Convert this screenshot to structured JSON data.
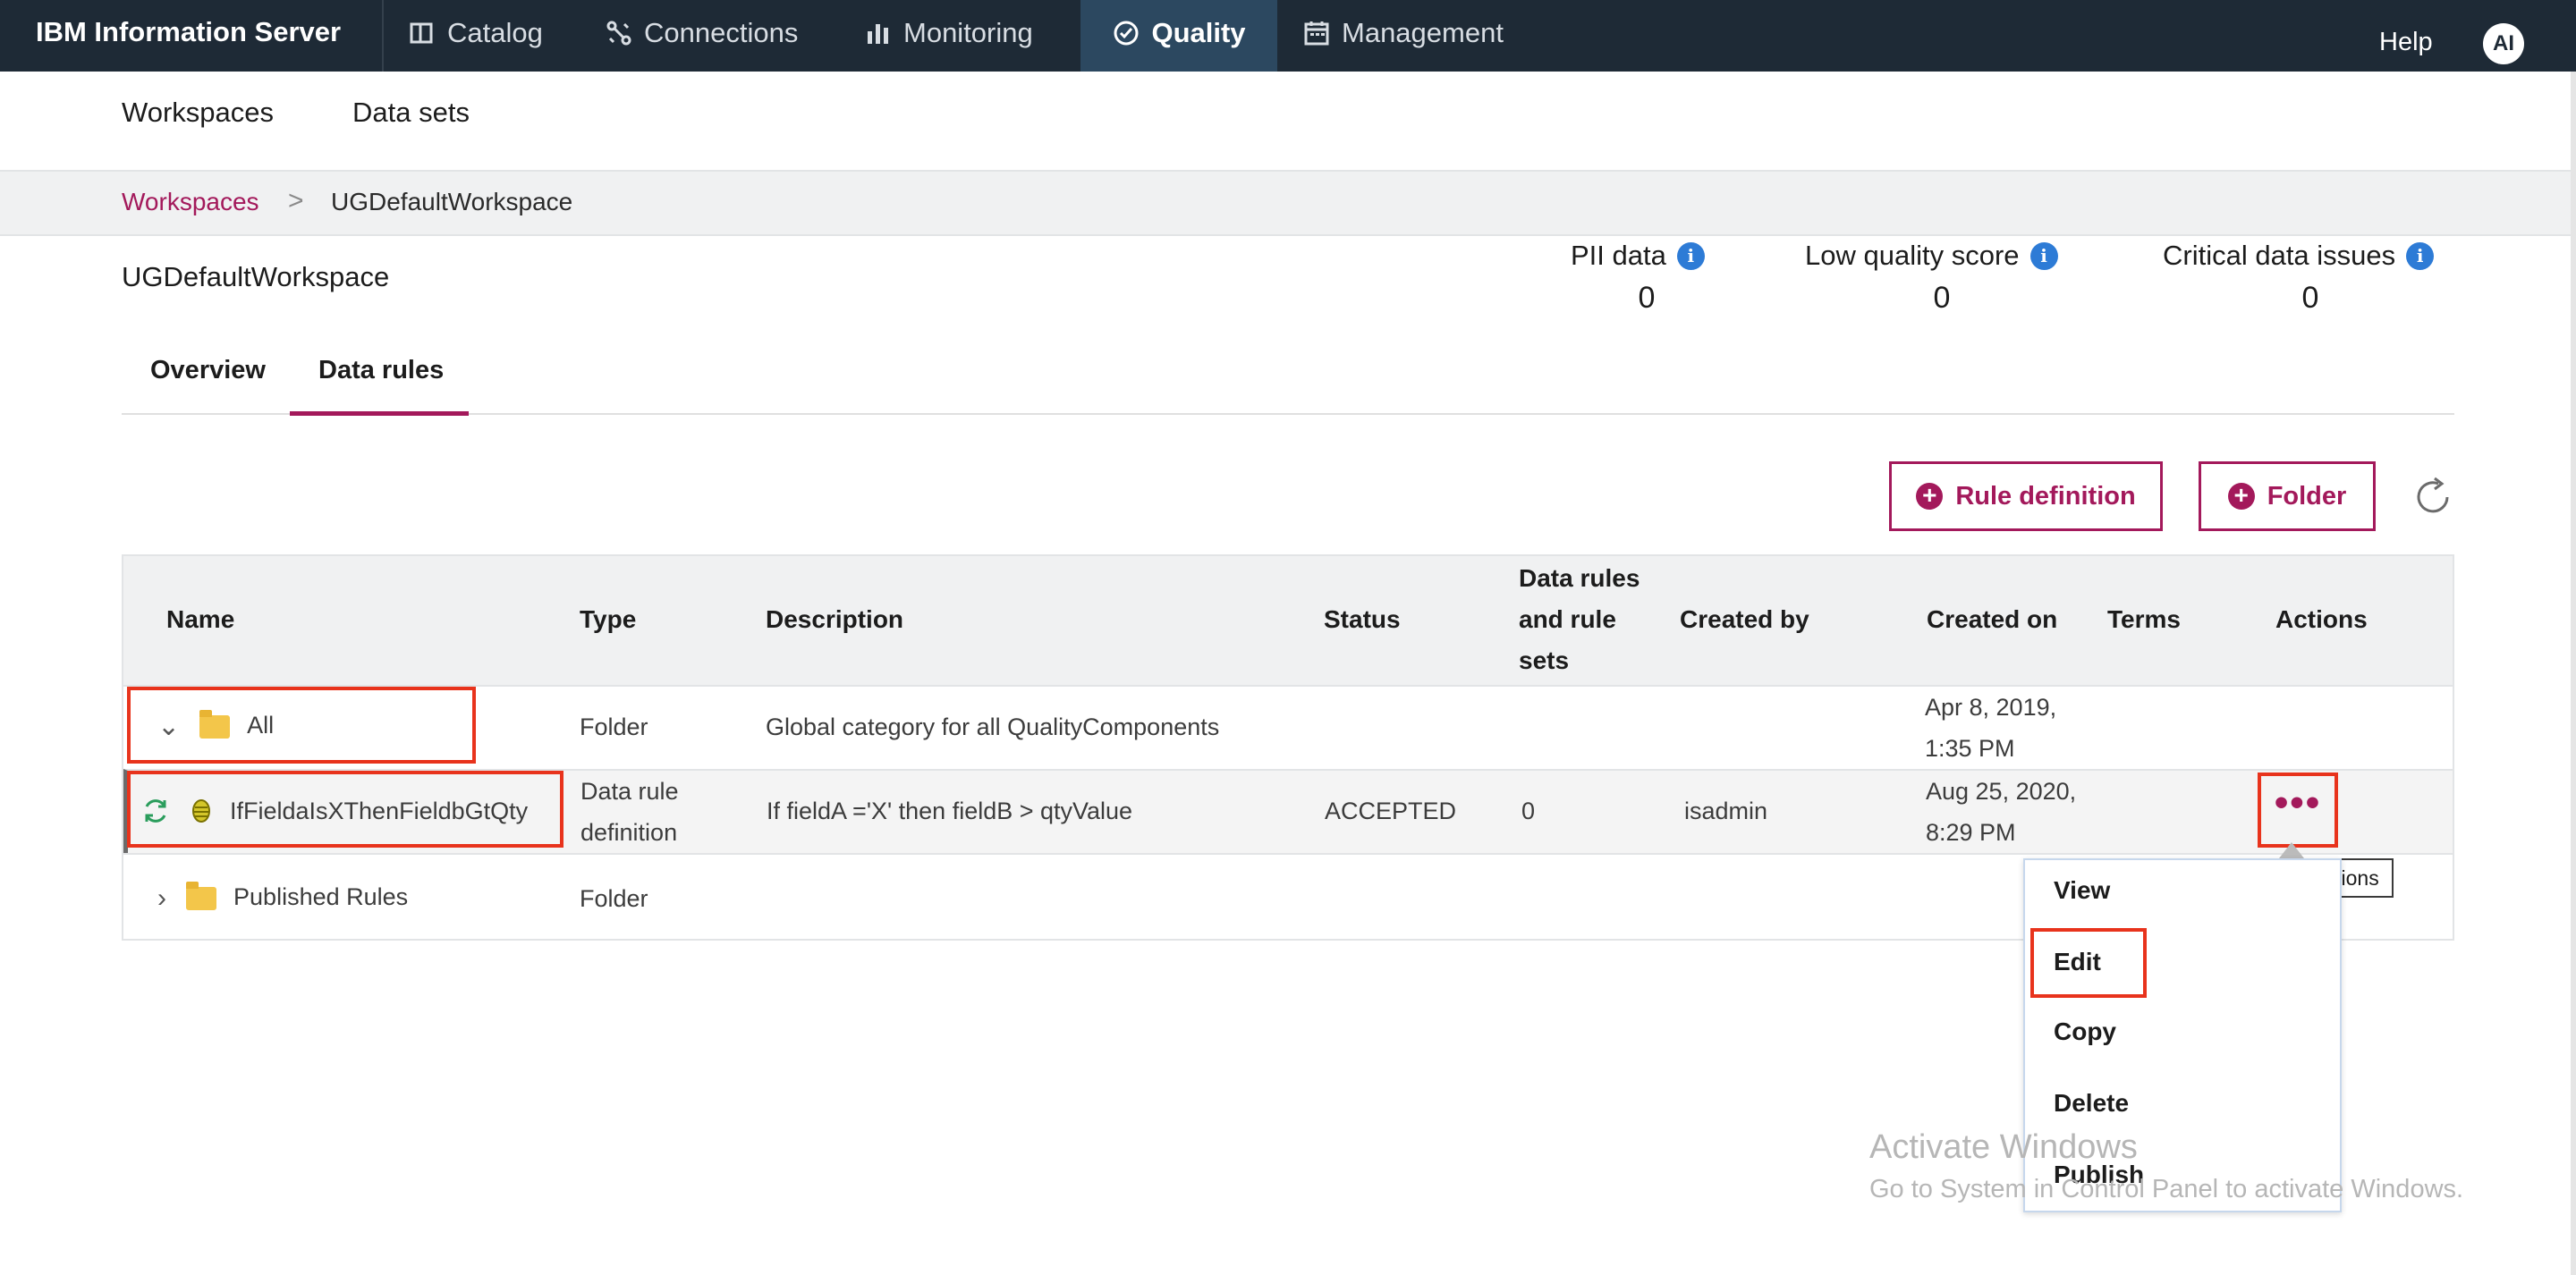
{
  "app": {
    "brand": "IBM Information Server",
    "nav": [
      {
        "label": "Catalog",
        "icon": "book-icon"
      },
      {
        "label": "Connections",
        "icon": "connections-icon"
      },
      {
        "label": "Monitoring",
        "icon": "bar-chart-icon"
      },
      {
        "label": "Quality",
        "icon": "check-circle-icon",
        "active": true
      },
      {
        "label": "Management",
        "icon": "calendar-icon"
      }
    ],
    "help": "Help",
    "avatar": "AI"
  },
  "subnav": {
    "workspaces": "Workspaces",
    "datasets": "Data sets"
  },
  "breadcrumb": {
    "parent": "Workspaces",
    "separator": ">",
    "current": "UGDefaultWorkspace"
  },
  "workspace": {
    "title": "UGDefaultWorkspace"
  },
  "stats": {
    "pii": {
      "label": "PII data",
      "value": "0"
    },
    "low_quality": {
      "label": "Low quality score",
      "value": "0"
    },
    "critical": {
      "label": "Critical data issues",
      "value": "0"
    }
  },
  "tabs": {
    "overview": "Overview",
    "data_rules": "Data rules",
    "active": "Data rules"
  },
  "toolbar": {
    "rule_definition": "Rule definition",
    "folder": "Folder"
  },
  "table": {
    "columns": {
      "name": "Name",
      "type": "Type",
      "description": "Description",
      "status": "Status",
      "data_rules_1": "Data rules",
      "data_rules_2": "and rule",
      "data_rules_3": "sets",
      "created_by": "Created by",
      "created_on": "Created on",
      "terms": "Terms",
      "actions": "Actions"
    },
    "rows": [
      {
        "name": "All",
        "type": "Folder",
        "description": "Global category for all QualityComponents",
        "status": "",
        "count": "",
        "created_by": "",
        "created_on_1": "Apr 8, 2019,",
        "created_on_2": "1:35 PM"
      },
      {
        "name": "IfFieldaIsXThenFieldbGtQty",
        "type_1": "Data rule",
        "type_2": "definition",
        "description": "If fieldA ='X' then fieldB > qtyValue",
        "status": "ACCEPTED",
        "count": "0",
        "created_by": "isadmin",
        "created_on_1": "Aug 25, 2020,",
        "created_on_2": "8:29 PM"
      },
      {
        "name": "Published Rules",
        "type": "Folder"
      }
    ],
    "actions_dots": "•••"
  },
  "tooltip": "Actions",
  "menu": {
    "view": "View",
    "edit": "Edit",
    "copy": "Copy",
    "delete": "Delete",
    "publish": "Publish"
  },
  "watermark": {
    "line1": "Activate Windows",
    "line2": "Go to System in Control Panel to activate Windows."
  },
  "colors": {
    "topbar": "#1e2a36",
    "active_tab": "#2c4860",
    "accent": "#a3195b",
    "highlight": "#e8331c",
    "info": "#2d7bd6"
  }
}
